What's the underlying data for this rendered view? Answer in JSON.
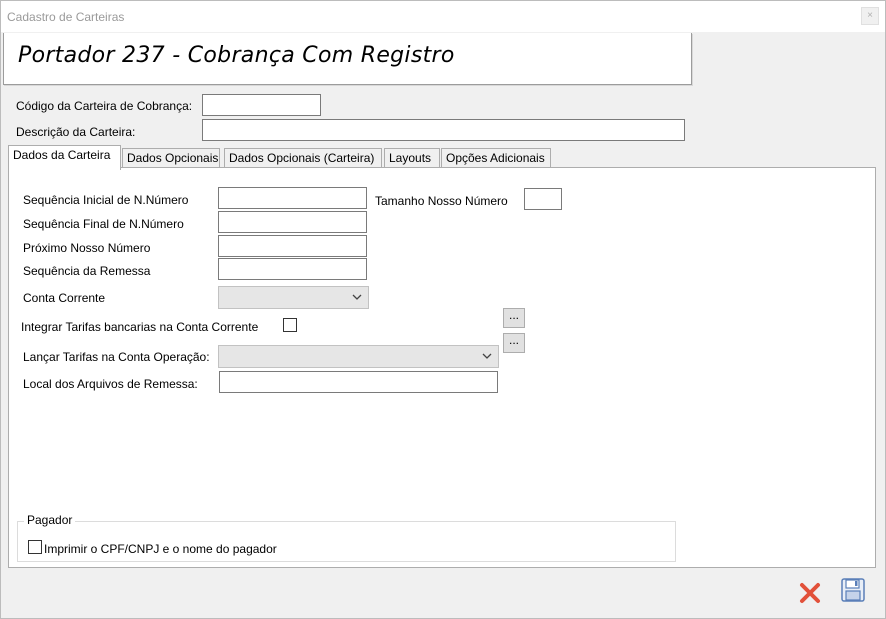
{
  "window": {
    "title": "Cadastro de Carteiras",
    "close_glyph": "×"
  },
  "header": {
    "heading": "Portador 237 - Cobrança Com Registro"
  },
  "form": {
    "codigo_label": "Código da Carteira de Cobrança:",
    "codigo_value": "",
    "descricao_label": "Descrição da Carteira:",
    "descricao_value": ""
  },
  "tabs": [
    {
      "label": "Dados da Carteira",
      "active": true
    },
    {
      "label": "Dados Opcionais",
      "active": false
    },
    {
      "label": "Dados Opcionais (Carteira)",
      "active": false
    },
    {
      "label": "Layouts",
      "active": false
    },
    {
      "label": "Opções Adicionais",
      "active": false
    }
  ],
  "dados_carteira": {
    "seq_inicial_label": "Sequência Inicial de N.Número",
    "seq_inicial_value": "",
    "tamanho_label": "Tamanho Nosso Número",
    "tamanho_value": "",
    "seq_final_label": "Sequência Final de N.Número",
    "seq_final_value": "",
    "proximo_label": "Próximo Nosso Número",
    "proximo_value": "",
    "seq_remessa_label": "Sequência da Remessa",
    "seq_remessa_value": "",
    "conta_corrente_label": "Conta Corrente",
    "conta_corrente_value": "",
    "integrar_label": "Integrar Tarifas bancarias na Conta Corrente",
    "integrar_checked": false,
    "ellipsis_label": "...",
    "lancar_label": "Lançar Tarifas na Conta Operação:",
    "lancar_value": "",
    "local_label": "Local dos Arquivos de Remessa:",
    "local_value": ""
  },
  "pagador": {
    "legend": "Pagador",
    "imprimir_label": "Imprimir o CPF/CNPJ e o nome do pagador",
    "imprimir_checked": false
  },
  "icons": {
    "cancel": "cancel-x-icon",
    "save": "save-disk-icon",
    "dropdown": "chevron-down-icon"
  },
  "colors": {
    "cancel_red": "#e2513a",
    "save_blue": "#5a7fb8"
  }
}
